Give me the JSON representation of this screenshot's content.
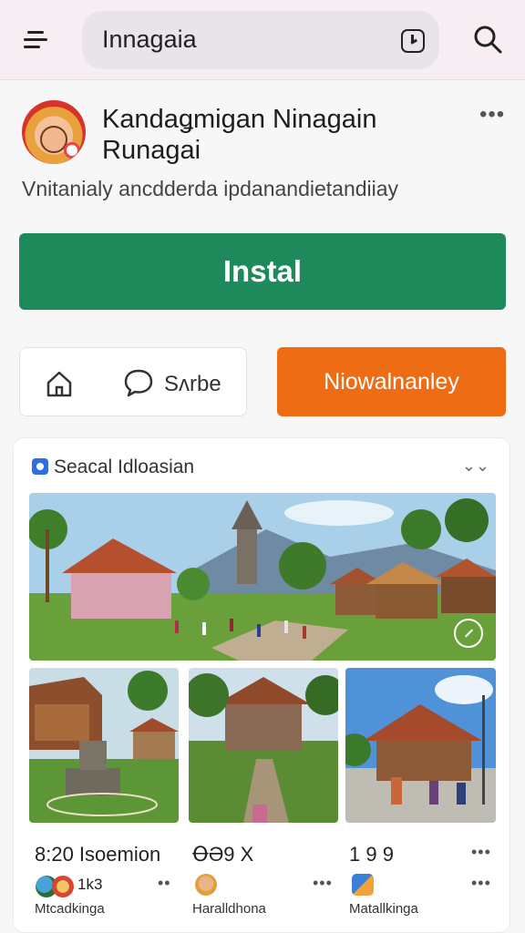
{
  "topbar": {
    "search_text": "Innagaia",
    "menu_icon": "menu-icon",
    "history_icon": "clock-icon",
    "search_icon": "search-icon"
  },
  "app": {
    "title": "Kandaǥmigan Ninagain Runagai",
    "subtitle": "Vnitanialy ancdderda ipdanandietandiiay",
    "install_label": "Instal",
    "share_label": "Sʌrbe",
    "secondary_label": "Niowalnanley",
    "more": "•••"
  },
  "card": {
    "title": "Seacal Idloasian",
    "more": "⌄⌄",
    "items": [
      {
        "meta": "8:20 Isoemion",
        "count": "1k3",
        "author": "Mtcadkinga",
        "more": "••"
      },
      {
        "meta": "ꝊƏ9 X",
        "author": "Haralldhona",
        "more": "•••"
      },
      {
        "meta": "1 9 9",
        "author": "Matallkinga",
        "more": "•••"
      }
    ]
  },
  "colors": {
    "install": "#1e8a5c",
    "secondary": "#ee6d14",
    "topbar": "#f6eef3",
    "accent_blue": "#2f6fe0"
  }
}
